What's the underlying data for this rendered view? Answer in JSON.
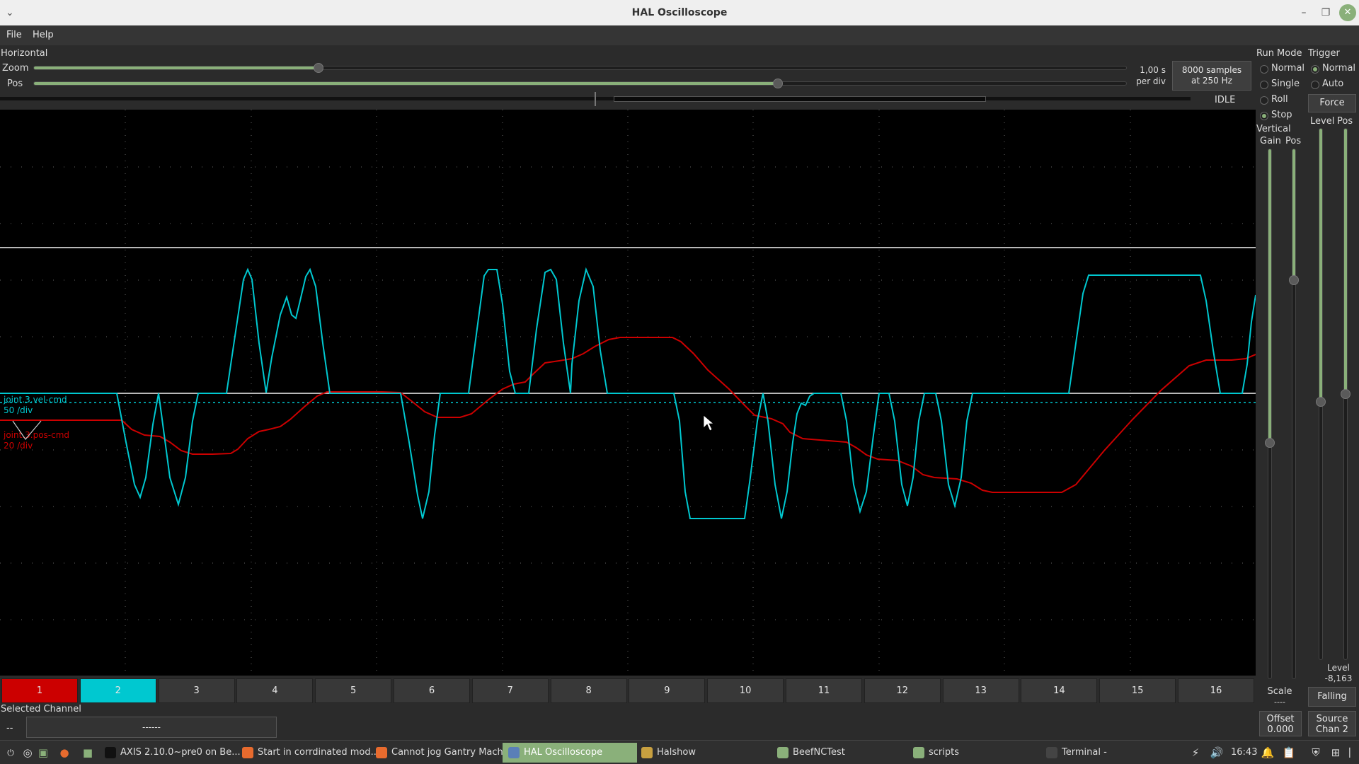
{
  "window": {
    "title": "HAL Oscilloscope"
  },
  "menu": {
    "file": "File",
    "help": "Help"
  },
  "horizontal": {
    "section": "Horizontal",
    "zoom_label": "Zoom",
    "pos_label": "Pos",
    "zoom_value": 0.26,
    "pos_value": 0.68,
    "rate_line1": "1,00 s",
    "rate_line2": "per div",
    "samples_line1": "8000 samples",
    "samples_line2": "at 250 Hz",
    "state": "IDLE"
  },
  "run_mode": {
    "title": "Run Mode",
    "options": [
      "Normal",
      "Single",
      "Roll",
      "Stop"
    ],
    "selected": "Stop"
  },
  "trigger": {
    "title": "Trigger",
    "options": [
      "Normal",
      "Auto"
    ],
    "selected": "Normal",
    "force": "Force",
    "level_label": "Level",
    "pos_label": "Pos",
    "level_readout_label": "Level",
    "level_readout_value": "-8,163",
    "edge": "Falling",
    "source_line1": "Source",
    "source_line2": "Chan 2"
  },
  "vertical": {
    "title": "Vertical",
    "gain_label": "Gain",
    "pos_label": "Pos",
    "scale_label": "Scale",
    "scale_value": "----",
    "offset_label": "Offset",
    "offset_value": "0.000"
  },
  "channels": {
    "buttons": [
      "1",
      "2",
      "3",
      "4",
      "5",
      "6",
      "7",
      "8",
      "9",
      "10",
      "11",
      "12",
      "13",
      "14",
      "15",
      "16"
    ],
    "selected_label": "Selected Channel",
    "selected_short": "--",
    "selected_value": "------"
  },
  "traces": {
    "ch2_name": "joint.3.vel-cmd",
    "ch2_scale": "50 /div",
    "ch1_name": "joint.3.pos-cmd",
    "ch1_scale": "20 /div",
    "ch1_color": "#cc0000",
    "ch2_color": "#00c8d0"
  },
  "taskbar": {
    "items": [
      "AXIS 2.10.0~pre0 on Be...",
      "Start in corrdinated mod...",
      "Cannot jog Gantry Machi...",
      "HAL Oscilloscope",
      "Halshow",
      "BeefNCTest",
      "scripts",
      "Terminal -"
    ],
    "clock": "16:43"
  }
}
